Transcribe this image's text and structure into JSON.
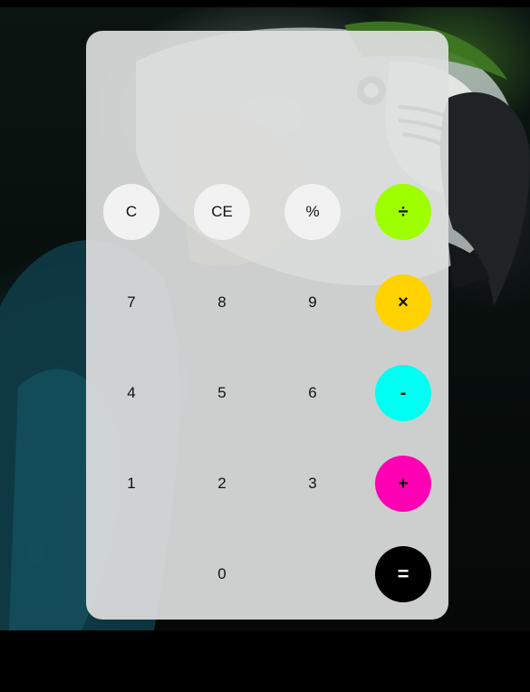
{
  "display": {
    "value": ""
  },
  "keys": {
    "clear": "C",
    "clear_entry": "CE",
    "percent": "%",
    "divide": "÷",
    "seven": "7",
    "eight": "8",
    "nine": "9",
    "multiply": "×",
    "four": "4",
    "five": "5",
    "six": "6",
    "subtract": "-",
    "one": "1",
    "two": "2",
    "three": "3",
    "add": "+",
    "zero": "0",
    "equals": "="
  },
  "colors": {
    "divide": "#9dff00",
    "multiply": "#ffd200",
    "subtract": "#00fff2",
    "add": "#ff00b4",
    "equals": "#000000",
    "function_key": "#f2f2f2"
  },
  "background": {
    "subject": "macaw-parrot-photo"
  }
}
